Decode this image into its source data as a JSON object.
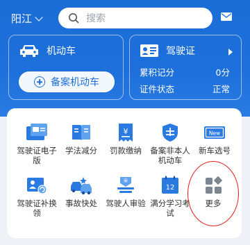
{
  "header": {
    "city": "阳江",
    "search_placeholder": "搜索"
  },
  "vehicle_card": {
    "title": "机动车",
    "register_button": "备案机动车"
  },
  "license_card": {
    "title": "驾驶证",
    "rows": [
      {
        "label": "累积记分",
        "value": "0分"
      },
      {
        "label": "证件状态",
        "value": "正常"
      }
    ]
  },
  "services": [
    {
      "label": "驾驶证电子版",
      "icon": "e-license-icon"
    },
    {
      "label": "学法减分",
      "icon": "book-icon"
    },
    {
      "label": "罚款缴纳",
      "icon": "fine-payment-icon"
    },
    {
      "label": "备案非本人机动车",
      "icon": "shield-record-icon"
    },
    {
      "label": "新车选号",
      "icon": "new-plate-icon"
    },
    {
      "label": "驾驶证补换领",
      "icon": "license-renew-icon"
    },
    {
      "label": "事故快处",
      "icon": "accident-icon"
    },
    {
      "label": "驾驶人审验",
      "icon": "driver-review-icon"
    },
    {
      "label": "满分学习考试",
      "icon": "calendar-exam-icon"
    },
    {
      "label": "更多",
      "icon": "more-grid-icon"
    }
  ],
  "colors": {
    "primary": "#1d6fdb",
    "icon_blue": "#2a7ae2",
    "highlight": "#e41c1c"
  }
}
